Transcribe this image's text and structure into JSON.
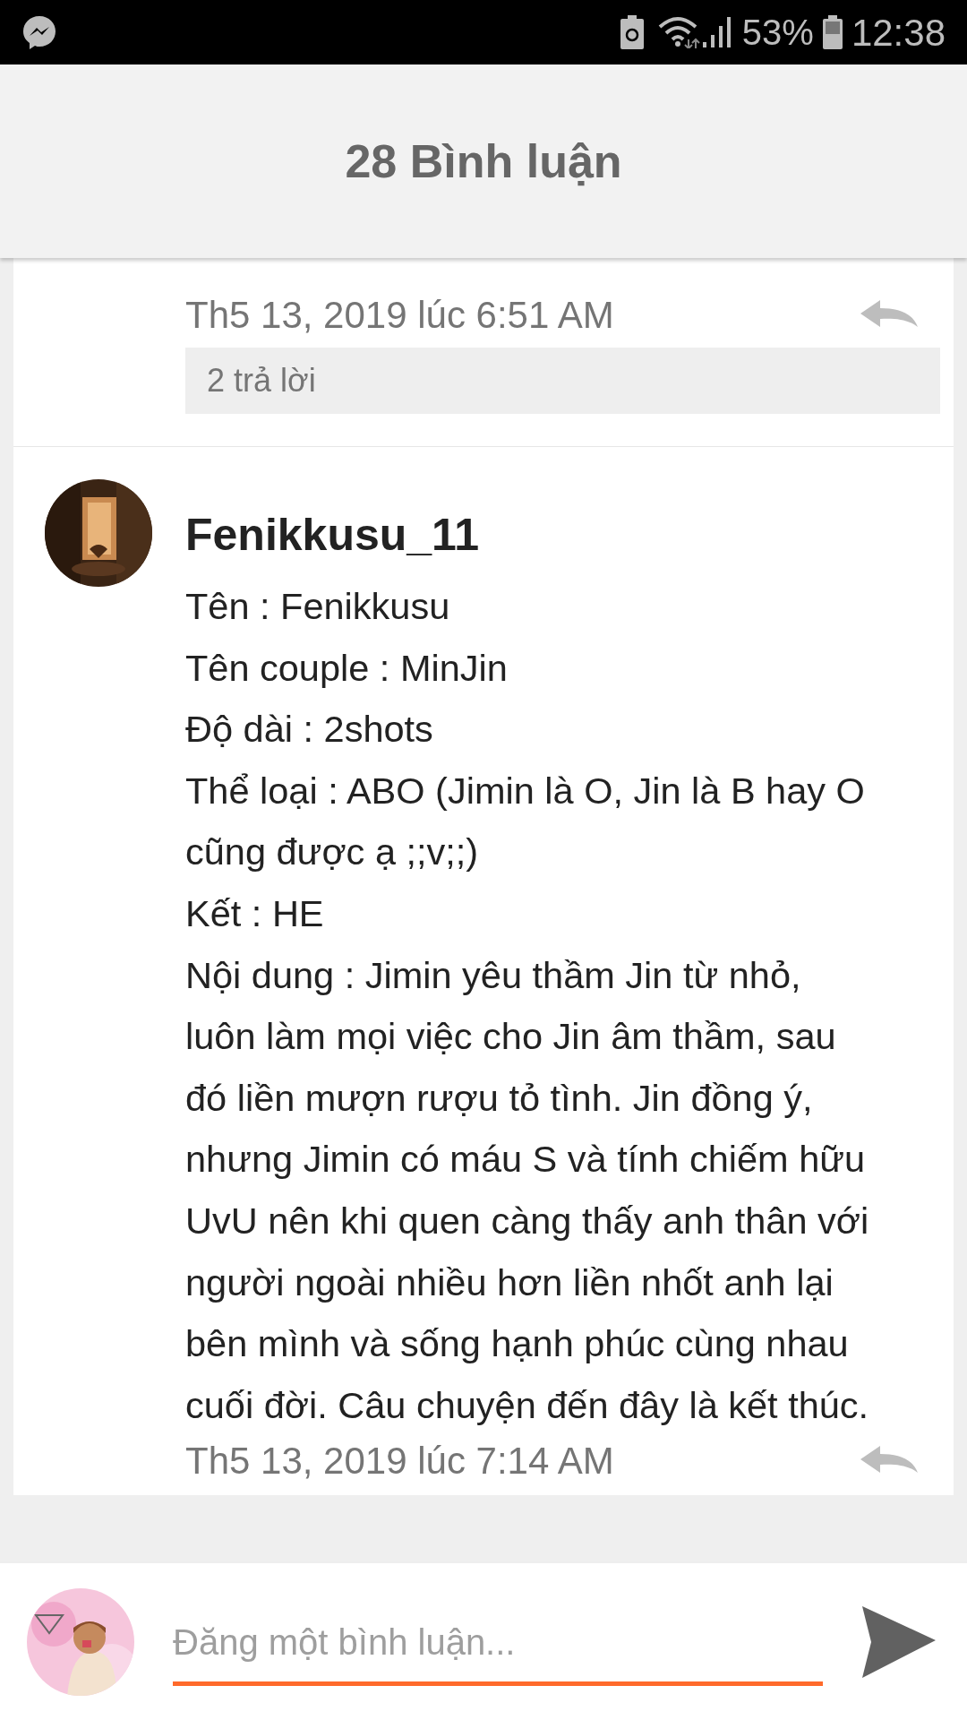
{
  "status_bar": {
    "battery_percent": "53%",
    "time": "12:38"
  },
  "header": {
    "title": "28 Bình luận"
  },
  "comments": [
    {
      "kind": "partial",
      "timestamp": "Th5 13, 2019 lúc 6:51 AM",
      "replies": "2 trả lời"
    },
    {
      "kind": "full",
      "author": "Fenikkusu_11",
      "lines": [
        "Tên : Fenikkusu",
        "Tên couple : MinJin",
        "Độ dài : 2shots",
        "Thể loại : ABO (Jimin là O, Jin là B hay O cũng được ạ ;;v;;)",
        "Kết : HE",
        "Nội dung : Jimin yêu thầm Jin từ nhỏ, luôn làm mọi việc cho Jin âm thầm, sau đó liền mượn rượu tỏ tình. Jin đồng ý, nhưng Jimin có máu S và tính chiếm hữu UvU nên khi quen càng thấy anh thân với người ngoài nhiều hơn liền nhốt anh lại bên mình và sống hạnh phúc cùng nhau cuối đời. Câu chuyện đến đây là kết thúc."
      ],
      "timestamp": "Th5 13, 2019 lúc 7:14 AM"
    }
  ],
  "composer": {
    "placeholder": "Đăng một bình luận..."
  }
}
